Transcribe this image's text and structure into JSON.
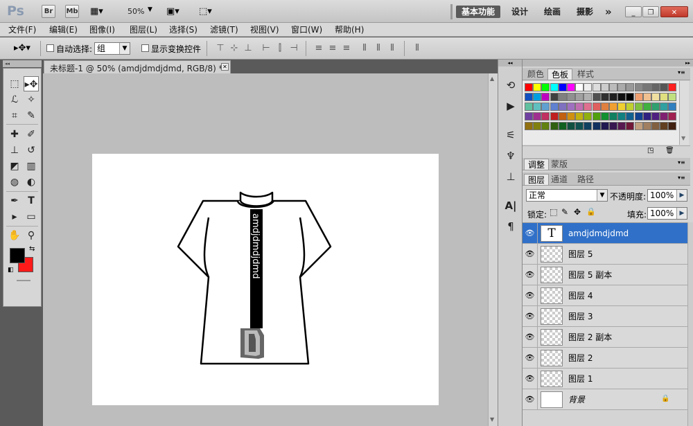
{
  "titlebar": {
    "logo": "Ps",
    "br": "Br",
    "mb": "Mb",
    "zoom": "50%",
    "workspaces": [
      "基本功能",
      "设计",
      "绘画",
      "摄影"
    ],
    "more": "»"
  },
  "menus": [
    "文件(F)",
    "编辑(E)",
    "图像(I)",
    "图层(L)",
    "选择(S)",
    "滤镜(T)",
    "视图(V)",
    "窗口(W)",
    "帮助(H)"
  ],
  "options": {
    "auto_select_label": "自动选择:",
    "auto_select_value": "组",
    "show_transform_label": "显示变换控件"
  },
  "document": {
    "tab_title": "未标题-1 @ 50% (amdjdmdjdmd, RGB/8) *",
    "vertical_text": "amdjdmdjdmd"
  },
  "color_panel": {
    "tabs": [
      "颜色",
      "色板",
      "样式"
    ]
  },
  "adjust_panel": {
    "tabs": [
      "调整",
      "蒙版"
    ]
  },
  "layers_panel": {
    "tabs": [
      "图层",
      "通道",
      "路径"
    ],
    "blend_mode": "正常",
    "opacity_label": "不透明度:",
    "opacity_value": "100%",
    "lock_label": "锁定:",
    "fill_label": "填充:",
    "fill_value": "100%",
    "layers": [
      {
        "name": "amdjdmdjdmd",
        "type": "text",
        "selected": true
      },
      {
        "name": "图层 5",
        "type": "pixel"
      },
      {
        "name": "图层 5 副本",
        "type": "pixel"
      },
      {
        "name": "图层 4",
        "type": "pixel"
      },
      {
        "name": "图层 3",
        "type": "pixel"
      },
      {
        "name": "图层 2 副本",
        "type": "pixel"
      },
      {
        "name": "图层 2",
        "type": "pixel"
      },
      {
        "name": "图层 1",
        "type": "pixel"
      },
      {
        "name": "背景",
        "type": "background"
      }
    ]
  },
  "colors": {
    "foreground": "#000000",
    "background": "#ff1a1a",
    "selection": "#3070c8"
  }
}
